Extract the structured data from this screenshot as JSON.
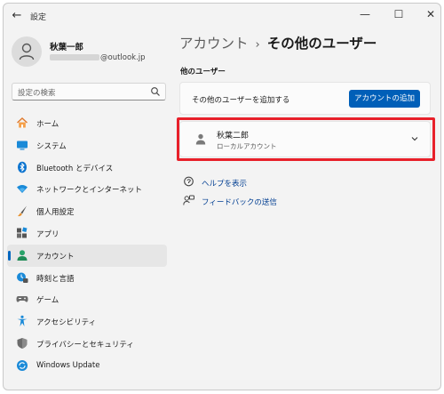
{
  "titlebar": {
    "app_title": "設定",
    "back": "←",
    "minimize": "—",
    "maximize": "☐",
    "close": "✕"
  },
  "profile": {
    "name": "秋葉一郎",
    "email_suffix": "@outlook.jp"
  },
  "search": {
    "placeholder": "設定の検索"
  },
  "nav": {
    "items": [
      {
        "label": "ホーム",
        "icon": "home-icon"
      },
      {
        "label": "システム",
        "icon": "system-icon"
      },
      {
        "label": "Bluetooth とデバイス",
        "icon": "bluetooth-icon"
      },
      {
        "label": "ネットワークとインターネット",
        "icon": "wifi-icon"
      },
      {
        "label": "個人用設定",
        "icon": "brush-icon"
      },
      {
        "label": "アプリ",
        "icon": "apps-icon"
      },
      {
        "label": "アカウント",
        "icon": "account-icon",
        "selected": true
      },
      {
        "label": "時刻と言語",
        "icon": "time-language-icon"
      },
      {
        "label": "ゲーム",
        "icon": "gaming-icon"
      },
      {
        "label": "アクセシビリティ",
        "icon": "accessibility-icon"
      },
      {
        "label": "プライバシーとセキュリティ",
        "icon": "shield-icon"
      },
      {
        "label": "Windows Update",
        "icon": "update-icon"
      }
    ]
  },
  "main": {
    "breadcrumb": {
      "parent": "アカウント",
      "separator": "›",
      "current": "その他のユーザー"
    },
    "section_label": "他のユーザー",
    "add_user": {
      "text": "その他のユーザーを追加する",
      "button": "アカウントの追加"
    },
    "other_user": {
      "name": "秋葉二郎",
      "type": "ローカルアカウント"
    },
    "links": [
      {
        "label": "ヘルプを表示",
        "icon": "help-icon"
      },
      {
        "label": "フィードバックの送信",
        "icon": "feedback-icon"
      }
    ]
  },
  "colors": {
    "accent": "#005fb8",
    "highlight": "#e8202a",
    "link": "#003e92"
  }
}
